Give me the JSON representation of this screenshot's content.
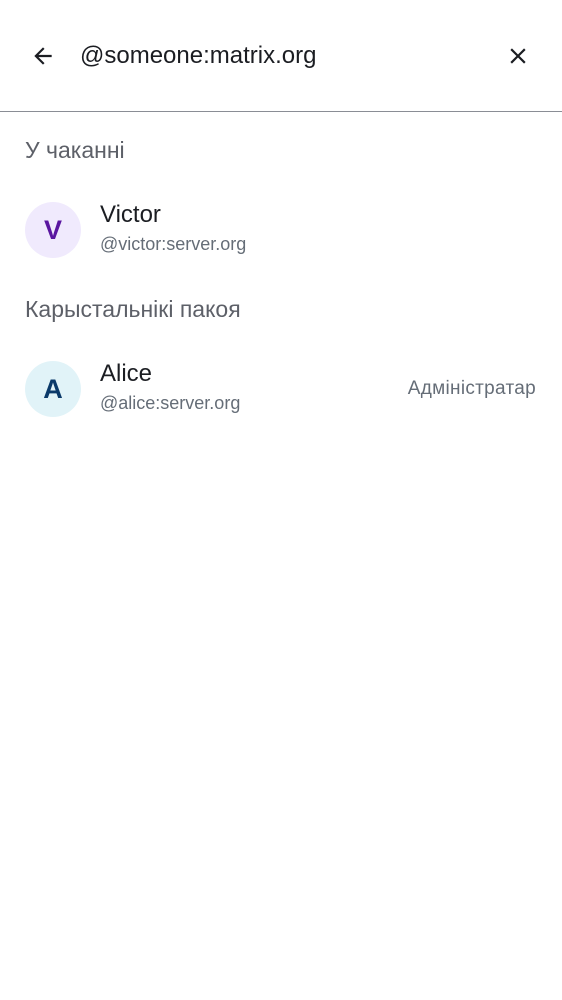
{
  "search": {
    "query": "@someone:matrix.org"
  },
  "sections": {
    "invited_title": "У чаканні",
    "members_title": "Карыстальнікі пакоя"
  },
  "invited": [
    {
      "initial": "V",
      "name": "Victor",
      "user_id": "@victor:server.org",
      "avatar_bg": "#f0eafd",
      "avatar_fg": "#5a16a0"
    }
  ],
  "members": [
    {
      "initial": "A",
      "name": "Alice",
      "user_id": "@alice:server.org",
      "role": "Адміністратар",
      "avatar_bg": "#e1f3f8",
      "avatar_fg": "#0b3a6a"
    }
  ],
  "colors": {
    "divider": "#8a8d95",
    "primary_text": "#1b1d22",
    "secondary_text": "#656d77"
  },
  "icons": {
    "back": "arrow-left-icon",
    "clear": "close-icon"
  }
}
